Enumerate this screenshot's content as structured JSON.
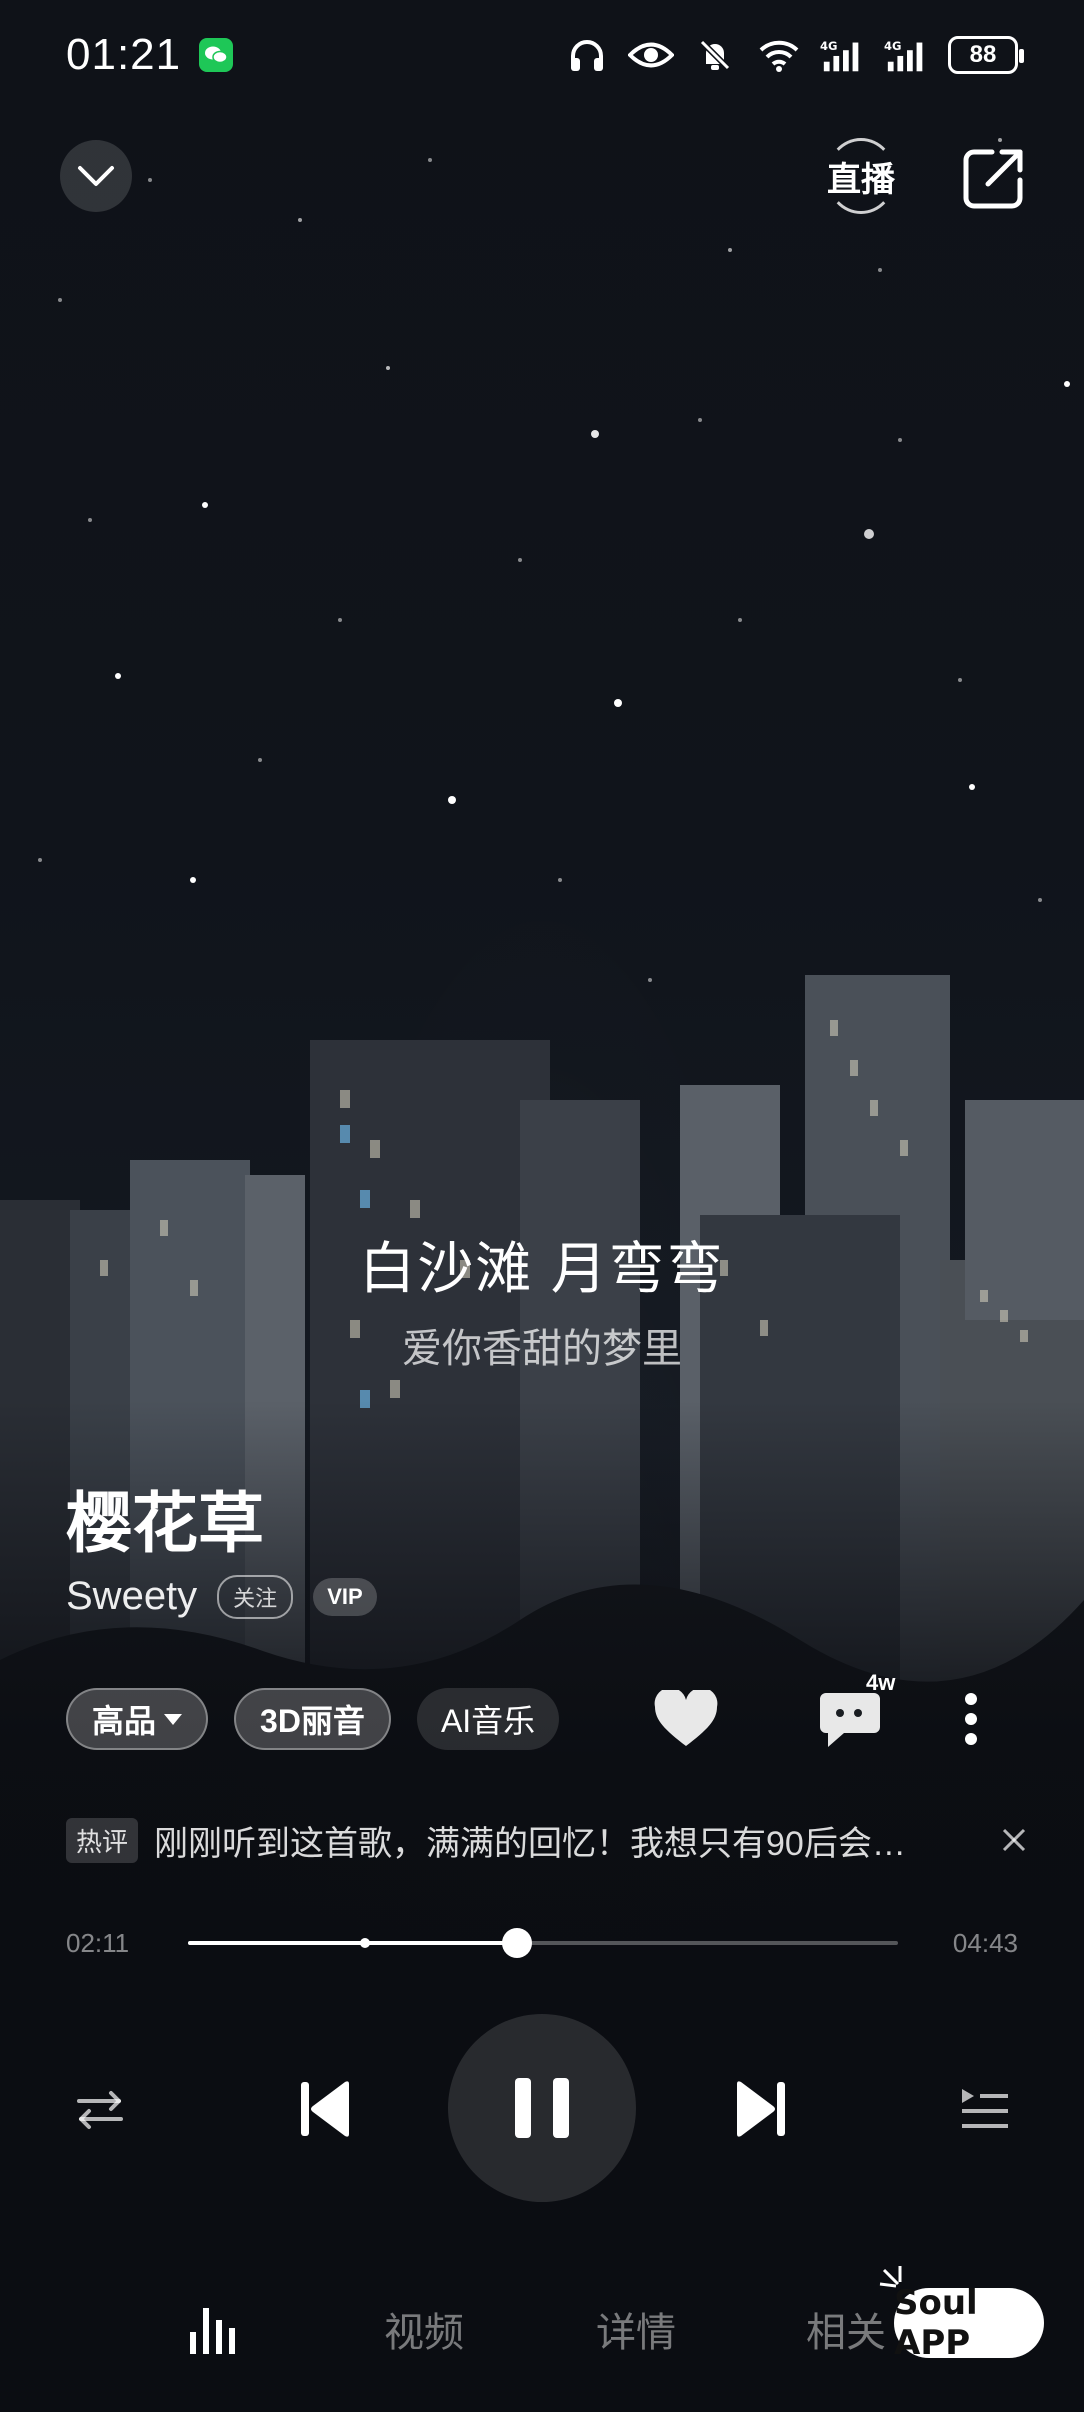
{
  "status_bar": {
    "time": "01:21",
    "battery": "88",
    "network": [
      "4G",
      "4G"
    ]
  },
  "top_bar": {
    "live_label": "直播"
  },
  "lyrics": {
    "current": "白沙滩 月弯弯",
    "next": "爱你香甜的梦里"
  },
  "song": {
    "title": "樱花草",
    "artist": "Sweety",
    "follow_label": "关注",
    "vip_label": "VIP"
  },
  "chips": {
    "quality": "高品",
    "sound": "3D丽音",
    "ai_music": "AI音乐"
  },
  "actions": {
    "comment_count": "4w"
  },
  "hot_comment": {
    "tag": "热评",
    "text": "刚刚听到这首歌，满满的回忆！我想只有90后会…"
  },
  "progress": {
    "elapsed": "02:11",
    "total": "04:43",
    "fraction": 0.463
  },
  "bottom_nav": {
    "items": [
      "视频",
      "详情",
      "相关"
    ]
  },
  "watermark": "Soul APP",
  "colors": {
    "background": "#0b0d12",
    "wechat_green": "#1ec757"
  }
}
